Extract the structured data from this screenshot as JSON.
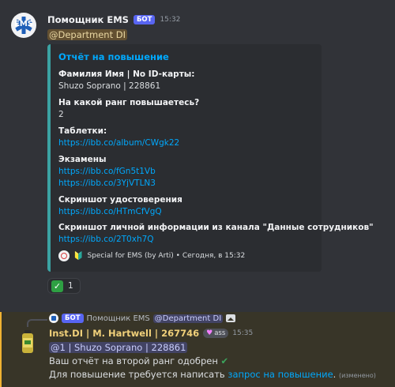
{
  "message1": {
    "author": "Помощник EMS",
    "bot_tag": "БОТ",
    "time": "15:32",
    "avatar_text": "EMS",
    "mention": "@Department DI",
    "embed": {
      "title": "Отчёт на повышение",
      "fields": [
        {
          "name": "Фамилия Имя | No ID-карты:",
          "values": [
            "Shuzo Soprano | 228861"
          ],
          "links": false
        },
        {
          "name": "На какой ранг повышаетесь?",
          "values": [
            "2"
          ],
          "links": false
        },
        {
          "name": "Таблетки:",
          "values": [
            "https://ibb.co/album/CWgk22"
          ],
          "links": true
        },
        {
          "name": "Экзамены",
          "values": [
            "https://ibb.co/fGn5t1Vb",
            "https://ibb.co/3YjVTLN3"
          ],
          "links": true
        },
        {
          "name": "Скриншот удостоверения",
          "values": [
            "https://ibb.co/HTmCfVgQ"
          ],
          "links": true
        },
        {
          "name": "Скриншот личной информации из канала \"Данные сотрудников\"",
          "values": [
            "https://ibb.co/2T0xh7Q"
          ],
          "links": true
        }
      ],
      "footer": "Special for EMS (by Arti) • Сегодня, в 15:32",
      "border_color": "#3ba3a3"
    },
    "reaction": {
      "emoji": "✓",
      "count": "1"
    }
  },
  "message2": {
    "reply": {
      "bot_tag": "БОТ",
      "author": "Помощник EMS",
      "mention": "@Department DI"
    },
    "author": "Inst.DI | M. Hartwell | 267746",
    "role_tag": "ass",
    "time": "15:35",
    "mention": "@1 | Shuzo Soprano | 228861",
    "line1": "Ваш отчёт на второй ранг одобрен",
    "line1_emoji": "✔",
    "line2_prefix": "Для повышение требуется написать",
    "line2_link": "запрос на повышение",
    "line2_suffix": ".",
    "edited": "(изменено)",
    "highlight_color": "#f0b232"
  }
}
